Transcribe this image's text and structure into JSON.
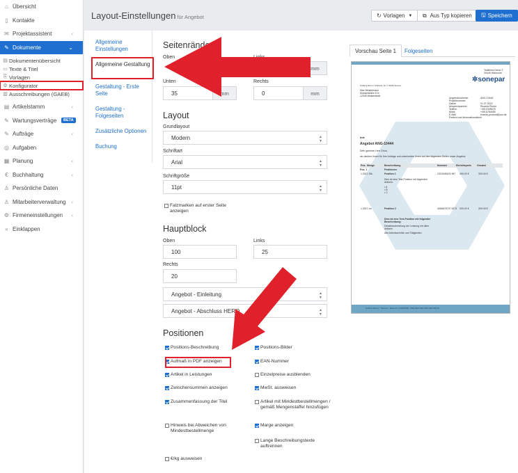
{
  "sidebar": {
    "items": [
      {
        "icon": "home-icon",
        "label": "Übersicht"
      },
      {
        "icon": "contacts-icon",
        "label": "Kontakte"
      },
      {
        "icon": "project-icon",
        "label": "Projektassistent",
        "chevron": "‹"
      },
      {
        "icon": "document-icon",
        "label": "Dokumente",
        "chevron": "⌄",
        "active": true
      }
    ],
    "subitems": [
      {
        "icon": "list-icon",
        "label": "Dokumentenübersicht"
      },
      {
        "icon": "text-icon",
        "label": "Texte & Titel"
      },
      {
        "icon": "template-icon",
        "label": "Vorlagen"
      },
      {
        "icon": "gear-icon",
        "label": "Konfigurator",
        "highlight": true
      },
      {
        "icon": "tender-icon",
        "label": "Ausschreibungen (GAEB)"
      }
    ],
    "items2": [
      {
        "icon": "article-icon",
        "label": "Artikelstamm",
        "chevron": "‹"
      },
      {
        "icon": "wrench-icon",
        "label": "Wartungsverträge",
        "badge": "BETA"
      },
      {
        "icon": "order-icon",
        "label": "Aufträge",
        "chevron": "‹"
      },
      {
        "icon": "task-icon",
        "label": "Aufgaben"
      },
      {
        "icon": "planning-icon",
        "label": "Planung",
        "chevron": "‹"
      },
      {
        "icon": "euro-icon",
        "label": "Buchhaltung",
        "chevron": "‹"
      },
      {
        "icon": "person-icon",
        "label": "Persönliche Daten"
      },
      {
        "icon": "staff-icon",
        "label": "Mitarbeiterverwaltung",
        "chevron": "‹"
      },
      {
        "icon": "company-icon",
        "label": "Firmeneinstellungen",
        "chevron": "‹"
      },
      {
        "icon": "collapse-icon",
        "label": "Einklappen"
      }
    ]
  },
  "header": {
    "title": "Layout-Einstellungen",
    "subtitle": "für Angebot",
    "btn_templates": "Vorlagen",
    "btn_copy": "Aus Typ kopieren",
    "btn_save": "Speichern"
  },
  "nav": {
    "general": "Allgemeine Einstellungen",
    "design": "Allgemeine Gestaltung",
    "first_page": "Gestaltung - Erste Seite",
    "following": "Gestaltung - Folgeseiten",
    "extra": "Zusätzliche Optionen",
    "booking": "Buchung"
  },
  "margins": {
    "title": "Seitenränder",
    "top_label": "Oben",
    "left_label": "Links",
    "bottom_label": "Unten",
    "bottom_value": "35",
    "right_label": "Rechts",
    "right_value": "0",
    "unit": "mm"
  },
  "layout": {
    "title": "Layout",
    "base_label": "Grundlayout",
    "base_value": "Modern",
    "font_label": "Schriftart",
    "font_value": "Arial",
    "size_label": "Schriftgröße",
    "size_value": "11pt",
    "fold_label": "Falzmarken auf erster Seite anzeigen"
  },
  "mainblock": {
    "title": "Hauptblock",
    "top_label": "Oben",
    "top_value": "100",
    "left_label": "Links",
    "left_value": "25",
    "right_label": "Rechts",
    "right_value": "20",
    "intro_select": "Angebot - Einleitung",
    "closing_select": "Angebot - Abschluss HERO"
  },
  "positions": {
    "title": "Positionen",
    "options": [
      {
        "label": "Positions-Beschreibung",
        "checked": true
      },
      {
        "label": "Positions-Bilder",
        "checked": true
      },
      {
        "label": "Aufmaß in PDF anzeigen",
        "checked": true
      },
      {
        "label": "EAN-Nummer",
        "checked": true
      },
      {
        "label": "Artikel in Leistungen",
        "checked": true
      },
      {
        "label": "Einzelpreise ausblenden",
        "checked": false
      },
      {
        "label": "Zwischensummen anzeigen",
        "checked": true
      },
      {
        "label": "MwSt. ausweisen",
        "checked": true
      },
      {
        "label": "Zusammenfassung der Titel",
        "checked": true
      },
      {
        "label": "Artikel mit Mindestbestellmengen / gemäß Mengenstaffel hinzufügen",
        "checked": false
      },
      {
        "label": "Hinweis bei Abweichen von Mindestbestellmenge",
        "checked": false
      },
      {
        "label": "Marge anzeigen",
        "checked": true
      },
      {
        "label": "Lange Beschreibungstexte auftrennen",
        "checked": false
      },
      {
        "label": "€/kg ausweisen",
        "checked": false
      }
    ]
  },
  "preview": {
    "tab_first": "Vorschau Seite 1",
    "tab_following": "Folgeseiten",
    "logo": "sonepar",
    "sender_line": "Testfirma Demo 2, Schlossstr. Str. 2, 30449 Hannover",
    "recipient": [
      "Max Mustermann",
      "Musterstraße 17a",
      "12345 Musterstadt"
    ],
    "meta_labels": [
      "Angebotsnummer",
      "Projektnummer",
      "Datum",
      "Ansprechpartner",
      "Telefon",
      "Mobil",
      "E-Mail",
      "Freitext und Informationsblock"
    ],
    "meta_values": [
      "ANG-10440",
      "",
      "01.07.2022",
      "Ricarda Pluem",
      "+4912345678",
      "+4915784455",
      "ricarda-product@yoo.de",
      ""
    ],
    "test": "test:",
    "heading": "Angebot ANG-10444",
    "salutation": "Sehr geehrter Herr Griva,",
    "intro": "wir danken Ihnen für Ihre Anfrage und unterbreiten Ihnen auf den folgenden Seiten unser Angebot.",
    "table_head": [
      "Pos.",
      "Menge",
      "Beschreibung",
      "Nummer",
      "Einheitspreis",
      "Gesamt"
    ],
    "pos1_title": "Positionen",
    "row1": [
      "1.001",
      "1 Stk",
      "Position 1",
      "2324345676 987",
      "300.00 €",
      "300.00 €"
    ],
    "row1_desc": "Dies ist eine Test-Position mit folgenden Artikeln:",
    "row1_items": [
      "• A",
      "• B",
      "• C"
    ],
    "row2": [
      "1.002",
      "1 m²",
      "Position 2",
      "4066678797 8373",
      "300.00 €",
      "300.00 €"
    ],
    "row2_desc": "Dies ist eine Text-Position mit folgender Beschreibung:",
    "row2_desc2": "Detailbeschreibung der Leistung mit allen Artikeln",
    "row2_desc3": "Alle Arbeitsschritte und Tätigkeiten",
    "footer": "Testfirma Demo 2 · Hannover · Steuer-Nr. 12/345/67890 · IBAN DE00 0000 0000 0000 0000 00"
  }
}
